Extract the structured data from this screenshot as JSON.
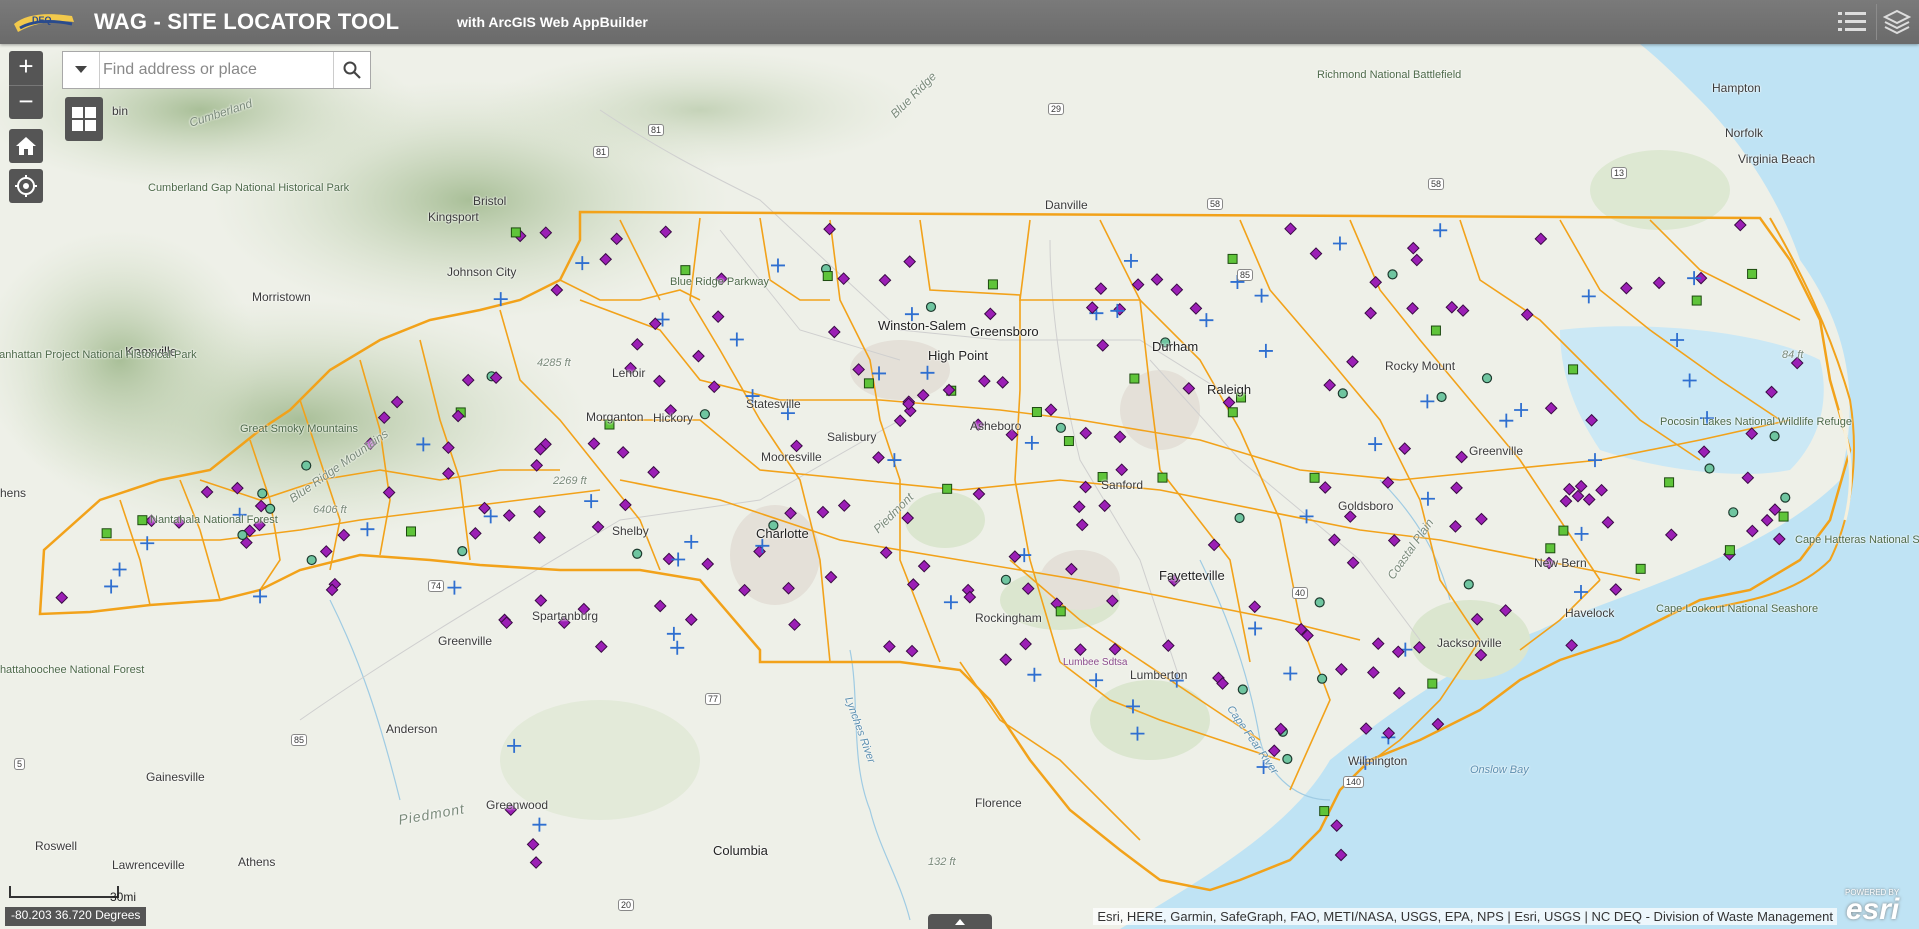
{
  "header": {
    "title": "WAG - SITE LOCATOR TOOL",
    "subtitle": "with ArcGIS Web AppBuilder",
    "logo_icon": "deq-logo-icon",
    "list_icon": "list-icon",
    "layers_icon": "layers-icon",
    "background_color": "#6e6e6e"
  },
  "search": {
    "placeholder": "Find address or place",
    "value": ""
  },
  "map": {
    "boundary_color": "#f2a21a",
    "water_color": "#bfe3f4",
    "marker_colors": {
      "purple_diamond": "#9b1fb5",
      "green_square": "#5fc43a",
      "teal_circle": "#6fc5a0",
      "blue_cross": "#2f6fd0"
    },
    "cities": [
      "Kingsport",
      "Bristol",
      "Johnson City",
      "Morristown",
      "Knoxville",
      "Danville",
      "Hampton",
      "Norfolk",
      "Virginia Beach",
      "Winston-Salem",
      "Greensboro",
      "High Point",
      "Durham",
      "Raleigh",
      "Rocky Mount",
      "Statesville",
      "Hickory",
      "Lenoir",
      "Morganton",
      "Salisbury",
      "Mooresville",
      "Asheboro",
      "Charlotte",
      "Shelby",
      "Sanford",
      "Fayetteville",
      "Goldsboro",
      "Greenville",
      "New Bern",
      "Jacksonville",
      "Havelock",
      "Rockingham",
      "Lumberton",
      "Wilmington",
      "Spartanburg",
      "Greenville",
      "Anderson",
      "Gainesville",
      "Greenwood",
      "Roswell",
      "Lawrenceville",
      "Athens",
      "Florence",
      "Columbia",
      "bin",
      "hens",
      "Lumbee Sdtsa"
    ],
    "parks": [
      "Cumberland Gap National Historical Park",
      "Manhattan Project National Historical Park",
      "Blue Ridge Parkway",
      "Great Smoky Mountains",
      "Nantahala National Forest",
      "Pocosin Lakes National Wildlife Refuge",
      "Cape Hatteras National Seashore",
      "Cape Lookout National Seashore",
      "Richmond National Battlefield",
      "Chattahoochee National Forest"
    ],
    "terrain_labels": [
      "Cumberland",
      "Blue Ridge",
      "Blue Ridge Mountains",
      "Piedmont",
      "Piedmont",
      "Coastal Plain"
    ],
    "water_labels": [
      "Onslow Bay",
      "Cape Fear River",
      "Lynches River"
    ],
    "elevations": [
      "6406 ft",
      "4285 ft",
      "2269 ft",
      "84 ft",
      "132 ft"
    ],
    "route_shields": [
      "81",
      "81",
      "29",
      "58",
      "58",
      "13",
      "85",
      "40",
      "74",
      "77",
      "85",
      "20",
      "140",
      "5"
    ]
  },
  "controls": {
    "zoom_in": "+",
    "zoom_out": "−",
    "home_icon": "home-icon",
    "locate_icon": "locate-icon",
    "grid_icon": "app-grid-icon"
  },
  "footer": {
    "scale_label": "30mi",
    "coordinates": "-80.203 36.720 Degrees",
    "attribution": "Esri, HERE, Garmin, SafeGraph, FAO, METI/NASA, USGS, EPA, NPS | Esri, USGS | NC DEQ - Division of Waste Management",
    "esri_powered": "POWERED BY",
    "esri_logo": "esri"
  }
}
